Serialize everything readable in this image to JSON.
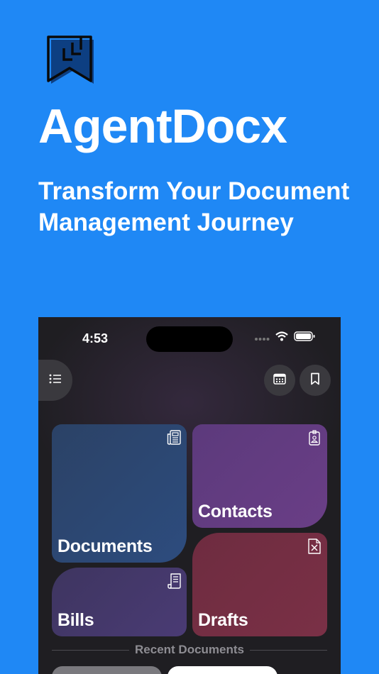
{
  "app": {
    "title": "AgentDocx",
    "tagline": "Transform Your Document Management Journey"
  },
  "phone": {
    "status_bar": {
      "time": "4:53",
      "icons": [
        "signal-dots-icon",
        "wifi-icon",
        "battery-icon"
      ]
    },
    "header": {
      "menu_icon": "list-icon",
      "calendar_icon": "calendar-icon",
      "bookmark_icon": "bookmark-icon"
    },
    "tiles": [
      {
        "label": "Documents",
        "icon": "newspaper-icon",
        "color": "#2d4c7e"
      },
      {
        "label": "Contacts",
        "icon": "id-badge-icon",
        "color": "#6a3e86"
      },
      {
        "label": "Bills",
        "icon": "receipt-icon",
        "color": "#4a3b74"
      },
      {
        "label": "Drafts",
        "icon": "doc-pencil-icon",
        "color": "#7a3046"
      }
    ],
    "recent": {
      "label": "Recent Documents"
    }
  },
  "colors": {
    "background": "#1f88f5",
    "phone_bg": "#1f1e22"
  }
}
